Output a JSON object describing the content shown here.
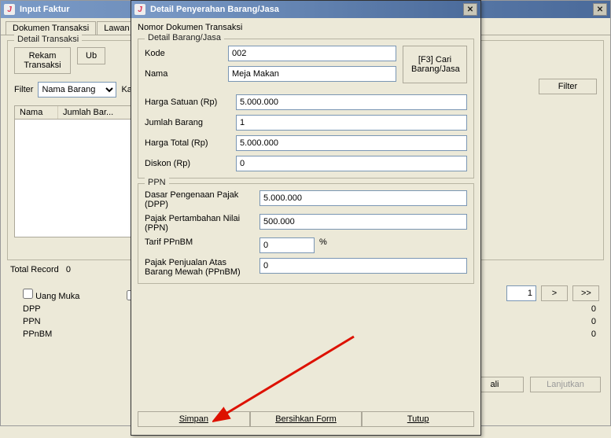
{
  "main": {
    "title": "Input Faktur",
    "tabs": [
      "Dokumen Transaksi",
      "Lawan Tr"
    ],
    "fieldset_title": "Detail Transaksi",
    "rekam_btn": "Rekam\nTransaksi",
    "ub_btn": "Ub",
    "filter_lbl": "Filter",
    "filter_select": "Nama Barang",
    "ka_lbl": "Ka",
    "cols": [
      "Nama",
      "Jumlah Bar..."
    ],
    "total_record_lbl": "Total Record",
    "total_record_val": "0",
    "uang_muka": "Uang Muka",
    "dpp": "DPP",
    "ppn": "PPN",
    "ppnbm": "PPnBM",
    "zero": "0",
    "page_val": "1",
    "next": ">",
    "last": ">>",
    "filter_btn": "Filter",
    "ali_btn": "ali",
    "lanjutkan": "Lanjutkan"
  },
  "dialog": {
    "title": "Detail Penyerahan Barang/Jasa",
    "nomor_dok": "Nomor Dokumen Transaksi",
    "fs_detail": "Detail Barang/Jasa",
    "kode_lbl": "Kode",
    "kode_val": "002",
    "nama_lbl": "Nama",
    "nama_val": "Meja Makan",
    "f3_btn": "[F3] Cari Barang/Jasa",
    "harga_satuan_lbl": "Harga Satuan (Rp)",
    "harga_satuan_val": "5.000.000",
    "jumlah_lbl": "Jumlah Barang",
    "jumlah_val": "1",
    "harga_total_lbl": "Harga Total (Rp)",
    "harga_total_val": "5.000.000",
    "diskon_lbl": "Diskon (Rp)",
    "diskon_val": "0",
    "fs_ppn": "PPN",
    "dpp_lbl": "Dasar Pengenaan Pajak (DPP)",
    "dpp_val": "5.000.000",
    "ppn_lbl": "Pajak Pertambahan Nilai (PPN)",
    "ppn_val": "500.000",
    "tarif_lbl": "Tarif PPnBM",
    "tarif_val": "0",
    "percent": "%",
    "ppnbm_lbl": "Pajak Penjualan Atas Barang Mewah (PPnBM)",
    "ppnbm_val": "0",
    "simpan": "Simpan",
    "bersih": "Bersihkan Form",
    "tutup": "Tutup"
  }
}
